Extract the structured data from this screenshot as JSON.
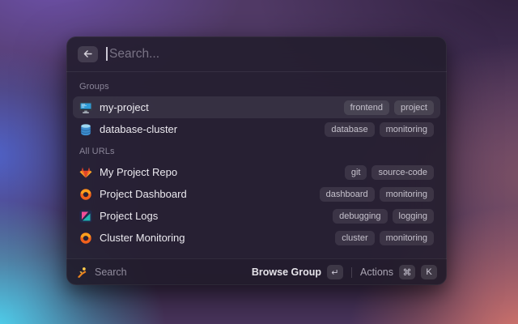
{
  "search": {
    "placeholder": "Search..."
  },
  "sections": [
    {
      "title": "Groups",
      "items": [
        {
          "icon": "desktop",
          "title": "my-project",
          "tags": [
            "frontend",
            "project"
          ],
          "selected": true
        },
        {
          "icon": "database",
          "title": "database-cluster",
          "tags": [
            "database",
            "monitoring"
          ],
          "selected": false
        }
      ]
    },
    {
      "title": "All URLs",
      "items": [
        {
          "icon": "gitlab",
          "title": "My Project Repo",
          "tags": [
            "git",
            "source-code"
          ],
          "selected": false
        },
        {
          "icon": "grafana",
          "title": "Project Dashboard",
          "tags": [
            "dashboard",
            "monitoring"
          ],
          "selected": false
        },
        {
          "icon": "kibana",
          "title": "Project Logs",
          "tags": [
            "debugging",
            "logging"
          ],
          "selected": false
        },
        {
          "icon": "grafana",
          "title": "Cluster Monitoring",
          "tags": [
            "cluster",
            "monitoring"
          ],
          "selected": false
        }
      ]
    }
  ],
  "footer": {
    "status_label": "Search",
    "primary_action": {
      "label": "Browse Group",
      "key": "↵"
    },
    "secondary_action": {
      "label": "Actions",
      "keys": [
        "⌘",
        "K"
      ]
    }
  },
  "colors": {
    "bg_base": "#513a66",
    "bg_purple": "#6c50a8",
    "bg_blue": "#4f62c8",
    "bg_cyan": "#4ed6f2",
    "bg_salmon": "#d8766b",
    "bg_mauve": "#7c5064",
    "bg_darkpurple": "#2e1f3c",
    "gitlab_red": "#e24329",
    "gitlab_orange": "#fc6d26",
    "gitlab_yellow": "#fca326",
    "grafana_orange": "#f2611c",
    "grafana_yellow": "#fba01e",
    "kibana_pink": "#f04e98",
    "kibana_teal": "#1bb9b4",
    "kibana_navy": "#222a4d",
    "db_blue": "#3e8fd0",
    "db_light": "#9fd8f2",
    "screen_blue": "#2f9bd8",
    "mascot_orange": "#e8821e",
    "mascot_yellow": "#ffcc4d"
  }
}
